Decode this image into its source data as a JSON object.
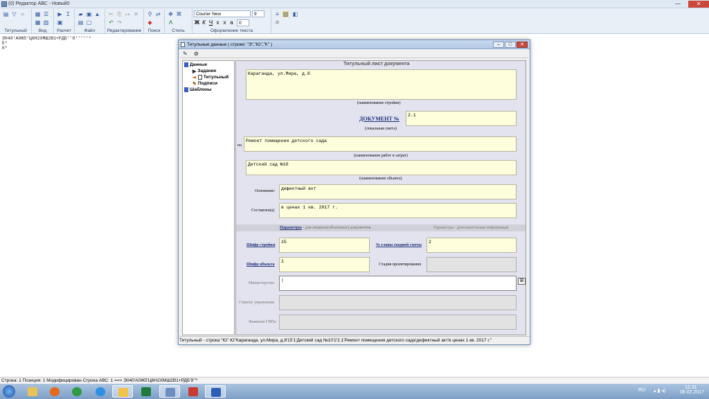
{
  "window": {
    "title": "(0) Редактор АВС - Новый0",
    "min": "—",
    "max": "□",
    "close": "✕"
  },
  "ribbon": {
    "groups": [
      "Титульный",
      "Вид",
      "Расчет",
      "Файл",
      "Редактирование",
      "Поиск",
      "Стиль",
      "Оформление текста"
    ],
    "font_name": "Courier New",
    "font_size": "9",
    "spacing": "0"
  },
  "document": {
    "lines": [
      "Э040'А0Ж5'Ц6Н2ХМШ2В1+РДБ''9'''''*",
      "Е*",
      "К*"
    ]
  },
  "dialog": {
    "title": "Титульные данные ( строки: \"Э\",\"Ю\",\"К\" )",
    "tree": {
      "data": "Данные",
      "task": "Задание",
      "title_item": "Титульный",
      "signatures": "Подписи",
      "templates": "Шаблоны"
    },
    "header": "Титульный лист документа",
    "address_value": "Караганда, ул.Мира, д.8",
    "address_caption": "(наименование стройки)",
    "doc_label": "ДОКУМЕНТ №",
    "doc_value": "2.1",
    "doc_caption": "(локальная смета)",
    "na_label": "на",
    "work_value": "Ремонт помещения детского сада",
    "work_caption": "(наименование работ и затрат)",
    "object_value": "Детский сад №10",
    "object_caption": "(наименование объекта)",
    "basis_label": "Основание:",
    "basis_value": "дефектный акт",
    "compiled_label": "Составлен(а)",
    "compiled_value": "в ценах 1 кв. 2017 г.",
    "params_link": "Параметры",
    "params_note": " - для сводных(объектных) документов",
    "params_extra": "Параметры - дополнительная информация",
    "cipher_build_label": "Шифр стройки",
    "cipher_build_value": "15",
    "chapter_label": "№ главы сводной сметы",
    "chapter_value": "2",
    "cipher_obj_label": "Шифр объекта",
    "cipher_obj_value": "1",
    "stage_label": "Стадия проектирования",
    "ministry_label": "Министерство",
    "ministry_value": "|",
    "main_dept_label": "Главное управление",
    "gip_label": "Фамилия ГИПа",
    "status": "Титульный - строка \"Ю\"     Ю\"Караганда, ул.Мира, д.8'15'1'Детский сад №10'2'2.1'Ремонт помещения детского сада'дефектный акт'в ценах 1 кв. 2017 г.\""
  },
  "appstatus": "Строка:  1   Позиция:  1       Модифицирован  Строка АВС:  1  ==>  Э040'А0Ж5'Ц6Н2ХМШ2В1+РДБ'9'''*",
  "taskbar": {
    "lang": "RU",
    "time": "11:31",
    "date": "08.02.2017"
  },
  "colors": {
    "field": "#fefddc",
    "panel": "#e3e3ef",
    "link": "#1d2f7a"
  }
}
